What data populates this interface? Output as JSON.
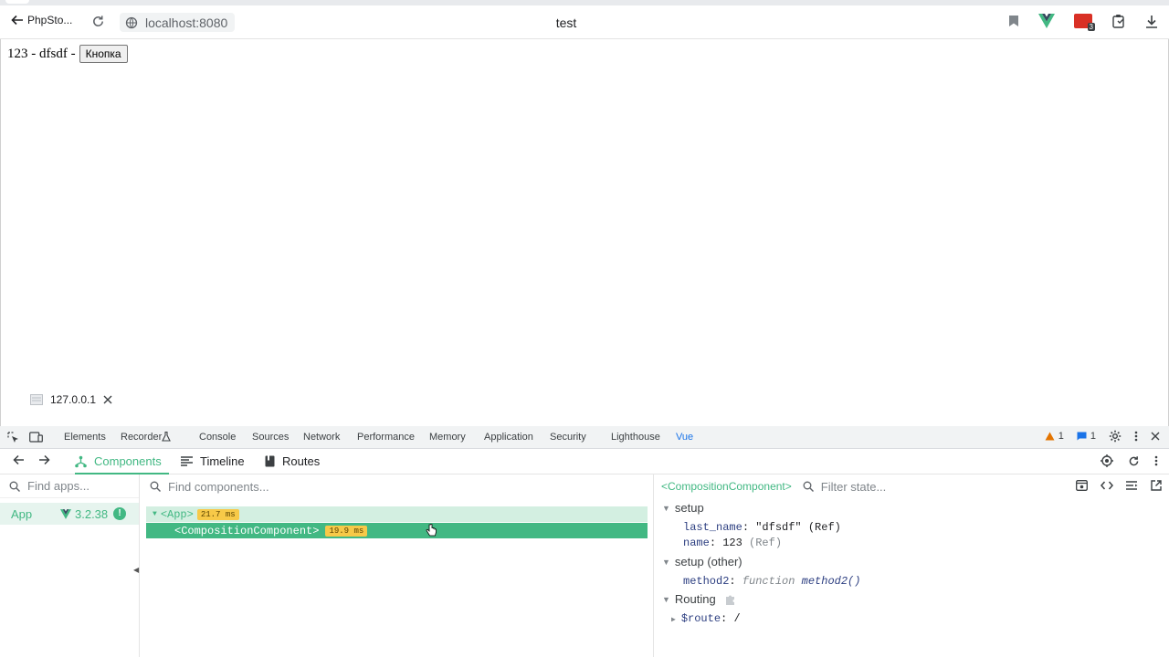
{
  "browser": {
    "back_label": "PhpSto...",
    "url": "localhost:8080",
    "page_title": "test",
    "ext_badge_count": "3",
    "icons": [
      "back-arrow-icon",
      "reload-icon",
      "site-info-icon",
      "bookmark-icon",
      "vue-devtools-icon",
      "extension-icon",
      "clipboard-icon",
      "download-icon"
    ]
  },
  "page": {
    "text": "123 - dfsdf -",
    "button_label": "Кнопка",
    "status_host": "127.0.0.1"
  },
  "devtools": {
    "tabs": [
      "Elements",
      "Recorder",
      "Console",
      "Sources",
      "Network",
      "Performance",
      "Memory",
      "Application",
      "Security",
      "Lighthouse",
      "Vue"
    ],
    "active_tab": "Vue",
    "warnings_count": "1",
    "messages_count": "1"
  },
  "vue": {
    "tabs": {
      "components": "Components",
      "timeline": "Timeline",
      "routes": "Routes"
    },
    "apps": {
      "search_placeholder": "Find apps...",
      "items": [
        {
          "name": "App",
          "version": "3.2.38"
        }
      ]
    },
    "tree": {
      "search_placeholder": "Find components...",
      "nodes": [
        {
          "label": "<App>",
          "time": "21.7 ms"
        },
        {
          "label": "<CompositionComponent>",
          "time": "19.9 ms"
        }
      ]
    },
    "state": {
      "component_name": "<CompositionComponent>",
      "filter_placeholder": "Filter state...",
      "sections": {
        "setup": "setup",
        "setup_other": "setup (other)",
        "routing": "Routing"
      },
      "props": {
        "last_name_key": "last_name",
        "last_name_value": "\"dfsdf\"",
        "last_name_note": "(Ref)",
        "name_key": "name",
        "name_value": "123",
        "name_note": "(Ref)",
        "method2_key": "method2",
        "method2_kw": "function",
        "method2_sig": "method2()",
        "route_key": "$route",
        "route_value": "/"
      }
    }
  },
  "colors": {
    "vue_green": "#42b883",
    "selection_light": "#d3efe1",
    "time_badge": "#f7c948",
    "devtools_blue": "#1a73e8"
  }
}
